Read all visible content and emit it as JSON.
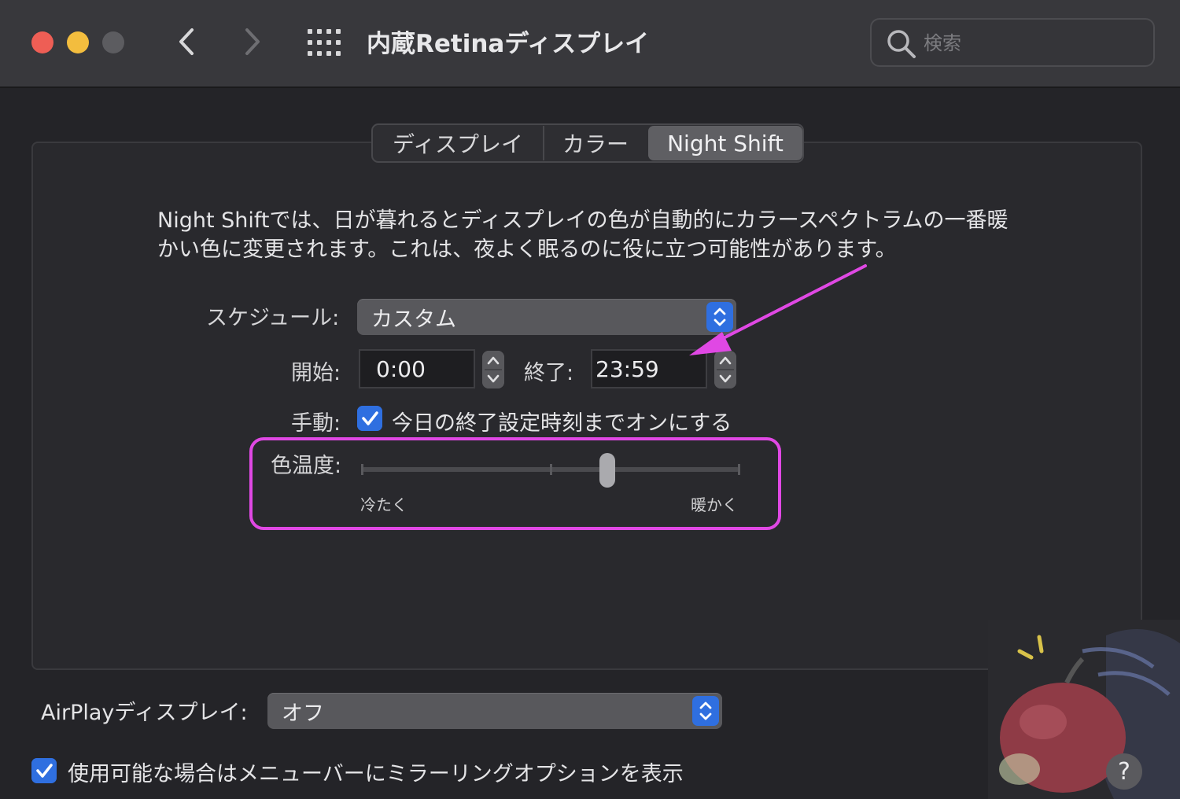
{
  "window": {
    "title": "内蔵Retinaディスプレイ",
    "search_placeholder": "検索"
  },
  "tabs": [
    {
      "label": "ディスプレイ",
      "selected": false
    },
    {
      "label": "カラー",
      "selected": false
    },
    {
      "label": "Night Shift",
      "selected": true
    }
  ],
  "night_shift": {
    "description_line1": "Night Shiftでは、日が暮れるとディスプレイの色が自動的にカラースペクトラムの一番暖",
    "description_line2": "かい色に変更されます。これは、夜よく眠るのに役に立つ可能性があります。",
    "schedule_label": "スケジュール:",
    "schedule_value": "カスタム",
    "start_label": "開始:",
    "start_value": "0:00",
    "end_label": "終了:",
    "end_value": "23:59",
    "manual_label": "手動:",
    "manual_checkbox_label": "今日の終了設定時刻までオンにする",
    "manual_checked": true,
    "temperature_label": "色温度:",
    "temperature_min_label": "冷たく",
    "temperature_max_label": "暖かく",
    "temperature_level": 0.65
  },
  "airplay": {
    "label": "AirPlayディスプレイ:",
    "value": "オフ",
    "mirror_checkbox_label": "使用可能な場合はメニューバーにミラーリングオプションを表示",
    "mirror_checked": true
  },
  "help_label": "?",
  "colors": {
    "accent": "#2f6fe0",
    "annotation": "#e048e4",
    "close": "#ee5e55",
    "minimize": "#f3bd3e"
  }
}
